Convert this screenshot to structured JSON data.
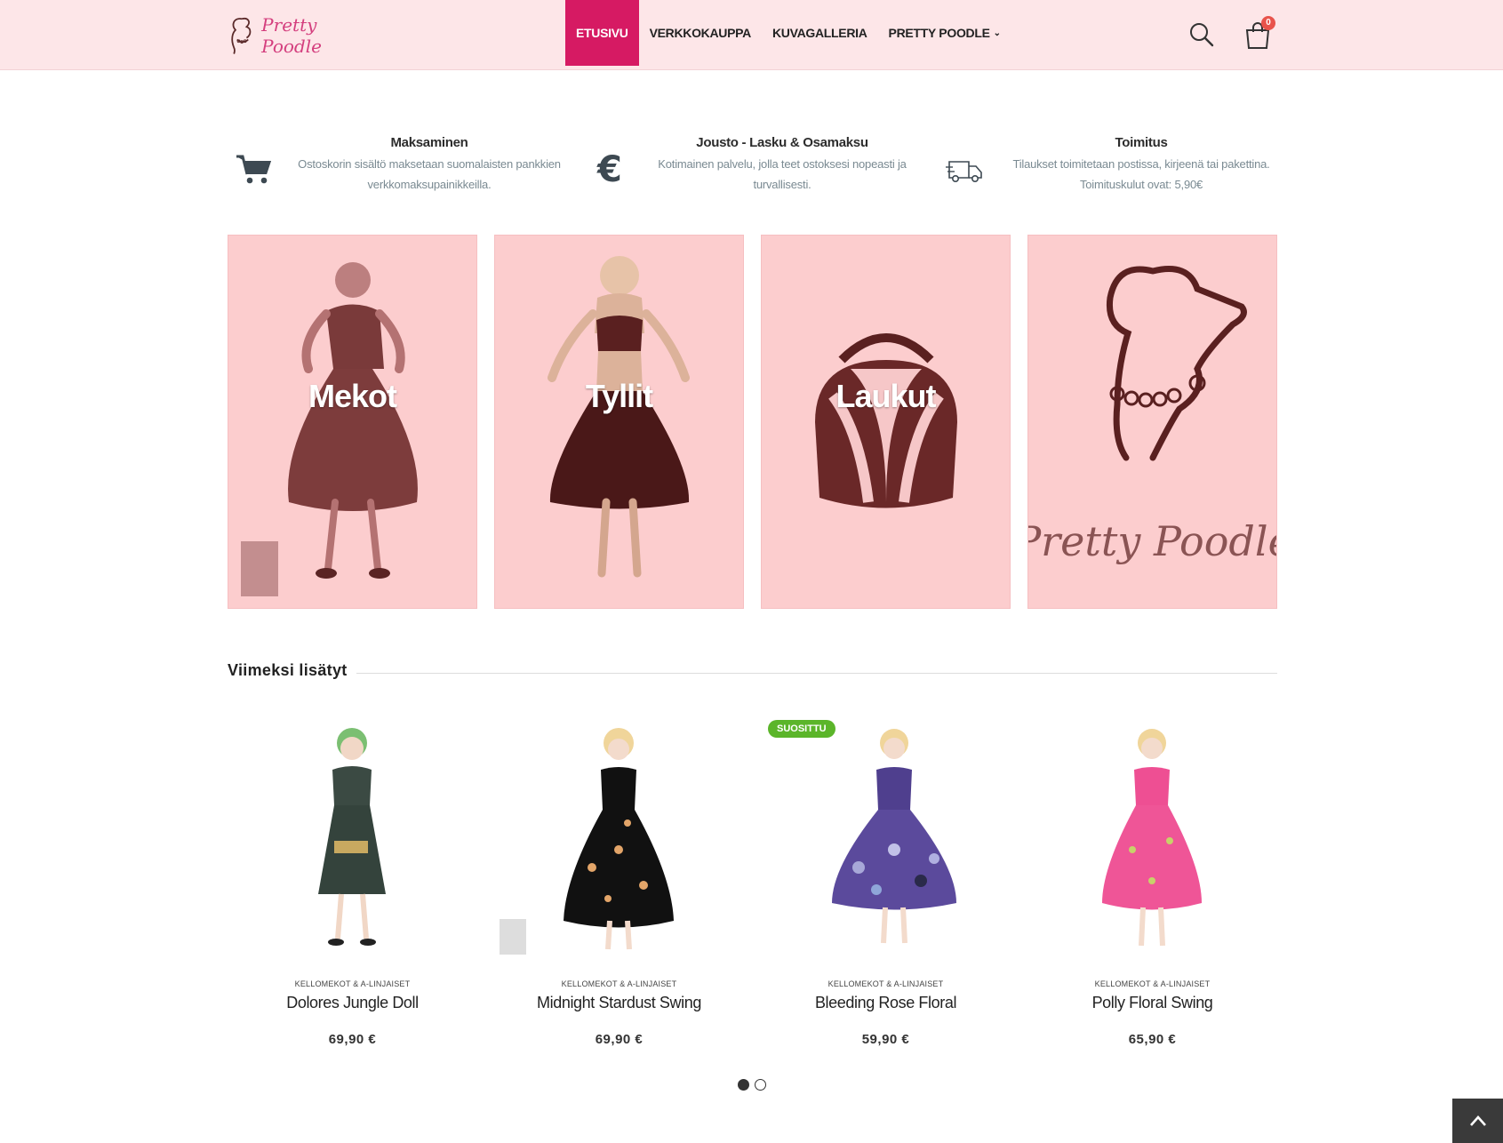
{
  "header": {
    "logo_text": "Pretty Poodle",
    "nav": [
      {
        "label": "ETUSIVU",
        "active": true
      },
      {
        "label": "VERKKOKAUPPA",
        "active": false
      },
      {
        "label": "KUVAGALLERIA",
        "active": false
      },
      {
        "label": "PRETTY POODLE",
        "active": false,
        "has_dropdown": true
      }
    ],
    "cart_count": "0",
    "icons": [
      "search-icon",
      "shopping-bag-icon"
    ],
    "colors": {
      "header_bg": "#fde6e8",
      "active_nav": "#d61a63",
      "badge": "#e8534b"
    }
  },
  "features": [
    {
      "icon": "cart-icon",
      "title": "Maksaminen",
      "line1": "Ostoskorin sisältö maksetaan suomalaisten pankkien",
      "line2": "verkkomaksupainikkeilla."
    },
    {
      "icon": "euro-icon",
      "title": "Jousto - Lasku & Osamaksu",
      "line1": "Kotimainen palvelu, jolla teet ostoksesi nopeasti ja",
      "line2": "turvallisesti."
    },
    {
      "icon": "truck-icon",
      "title": "Toimitus",
      "line1": "Tilaukset toimitetaan postissa, kirjeenä tai pakettina.",
      "line2": "Toimituskulut ovat: 5,90€"
    }
  ],
  "banners": [
    {
      "label": "Mekot"
    },
    {
      "label": "Tyllit"
    },
    {
      "label": "Laukut"
    },
    {
      "label": "",
      "logo_text": "Pretty Poodle"
    }
  ],
  "latest": {
    "title": "Viimeksi lisätyt",
    "products": [
      {
        "category": "KELLOMEKOT & A-LINJAISET",
        "name": "Dolores Jungle Doll",
        "price": "69,90  €",
        "badge": ""
      },
      {
        "category": "KELLOMEKOT & A-LINJAISET",
        "name": "Midnight Stardust Swing",
        "price": "69,90  €",
        "badge": ""
      },
      {
        "category": "KELLOMEKOT & A-LINJAISET",
        "name": "Bleeding Rose Floral",
        "price": "59,90  €",
        "badge": "SUOSITTU"
      },
      {
        "category": "KELLOMEKOT & A-LINJAISET",
        "name": "Polly Floral Swing",
        "price": "65,90  €",
        "badge": ""
      }
    ],
    "carousel_page": 1,
    "carousel_pages": 2
  }
}
